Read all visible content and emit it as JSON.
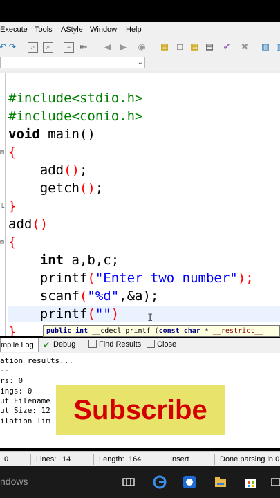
{
  "menu": {
    "items": [
      "Execute",
      "Tools",
      "AStyle",
      "Window",
      "Help"
    ]
  },
  "toolbar": {
    "icons": [
      "undo-icon",
      "redo-icon",
      "find-icon",
      "replace-icon",
      "indent-icon",
      "unindent-icon",
      "bookmark-icon",
      "toggle-icon",
      "layout-icon",
      "grid-icon",
      "check-icon",
      "stop-icon",
      "chart-icon"
    ]
  },
  "combo": {
    "value": ""
  },
  "code": {
    "l1_a": "#include<stdio.h>",
    "l2_a": "#include<conio.h>",
    "l3_kw": "void",
    "l3_b": " main()",
    "l4_br": "{",
    "l5_a": "    add",
    "l5_br": "()",
    "l5_c": ";",
    "l6_a": "    getch",
    "l6_br": "()",
    "l6_c": ";",
    "l7_br": "}",
    "l8_a": "add",
    "l8_br": "()",
    "l9_br": "{",
    "l10_kw": "    int",
    "l10_b": " a,b,c;",
    "l11_a": "    printf",
    "l11_b": "(",
    "l11_st": "\"Enter two number\"",
    "l11_c": ");",
    "l12_a": "    scanf",
    "l12_b": "(",
    "l12_st": "\"%d\"",
    "l12_c": ",&a);",
    "l13_a": "    printf",
    "l13_b": "(",
    "l13_st": "\"\"",
    "l13_c": ")"
  },
  "cursor": "I",
  "tooltip": {
    "kw1": "public int",
    "plain1": " __cdecl printf (",
    "kw2": "const char",
    "plain2": " * ",
    "id": "__restrict__"
  },
  "tabs": {
    "compile_log": "mpile Log",
    "debug": "Debug",
    "find_results": "Find Results",
    "close": "Close"
  },
  "log": {
    "l1": "ation results...",
    "l2": "--",
    "l3": "rs: 0",
    "l4": "ings: 0",
    "l5": "ut Filename",
    "l6": "ut Size: 12",
    "l7": "ilation Tim"
  },
  "overlay": {
    "subscribe": "Subscribe"
  },
  "status": {
    "col": "0",
    "lines_label": "Lines:",
    "lines_value": "14",
    "length_label": "Length:",
    "length_value": "164",
    "mode": "Insert",
    "message": "Done parsing in 0."
  },
  "taskbar": {
    "label": "ndows"
  },
  "colors": {
    "preprocessor": "#008000",
    "bracket": "#ff0000",
    "string": "#0000ff",
    "subscribe_bg": "#e8e36a",
    "subscribe_text": "#d40000"
  }
}
